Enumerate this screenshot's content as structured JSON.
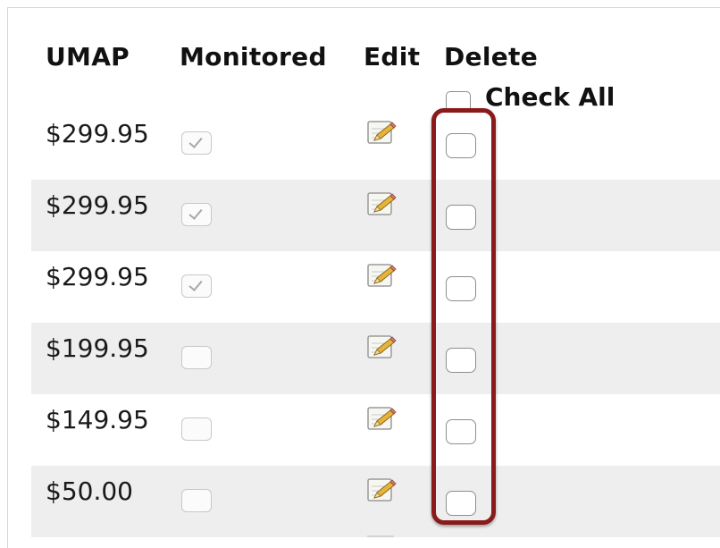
{
  "header": {
    "umap": "UMAP",
    "monitored": "Monitored",
    "edit": "Edit",
    "delete": "Delete",
    "check_all": "Check All"
  },
  "rows": [
    {
      "price": "$299.95",
      "monitored": true
    },
    {
      "price": "$299.95",
      "monitored": true
    },
    {
      "price": "$299.95",
      "monitored": true
    },
    {
      "price": "$199.95",
      "monitored": false
    },
    {
      "price": "$149.95",
      "monitored": false
    },
    {
      "price": "$50.00",
      "monitored": false
    }
  ],
  "icons": {
    "edit": "edit-pencil-icon"
  },
  "colors": {
    "highlight": "#8b1a1a",
    "row_shade": "#eeeeee"
  }
}
